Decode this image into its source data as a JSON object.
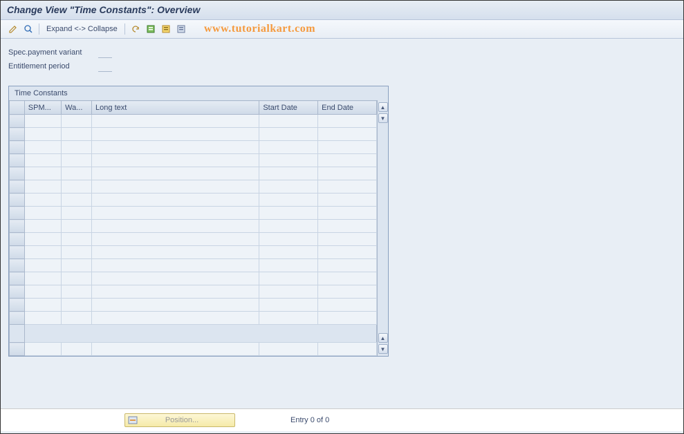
{
  "title": "Change View \"Time Constants\": Overview",
  "toolbar": {
    "expand_label": "Expand <-> Collapse"
  },
  "watermark": "www.tutorialkart.com",
  "fields": {
    "spec_payment_label": "Spec.payment variant",
    "entitlement_label": "Entitlement period"
  },
  "panel": {
    "title": "Time Constants",
    "columns": {
      "spmd": "SPM...",
      "wa": "Wa...",
      "long_text": "Long text",
      "start_date": "Start Date",
      "end_date": "End Date"
    }
  },
  "footer": {
    "position_label": "Position...",
    "entry_label": "Entry 0 of 0"
  }
}
